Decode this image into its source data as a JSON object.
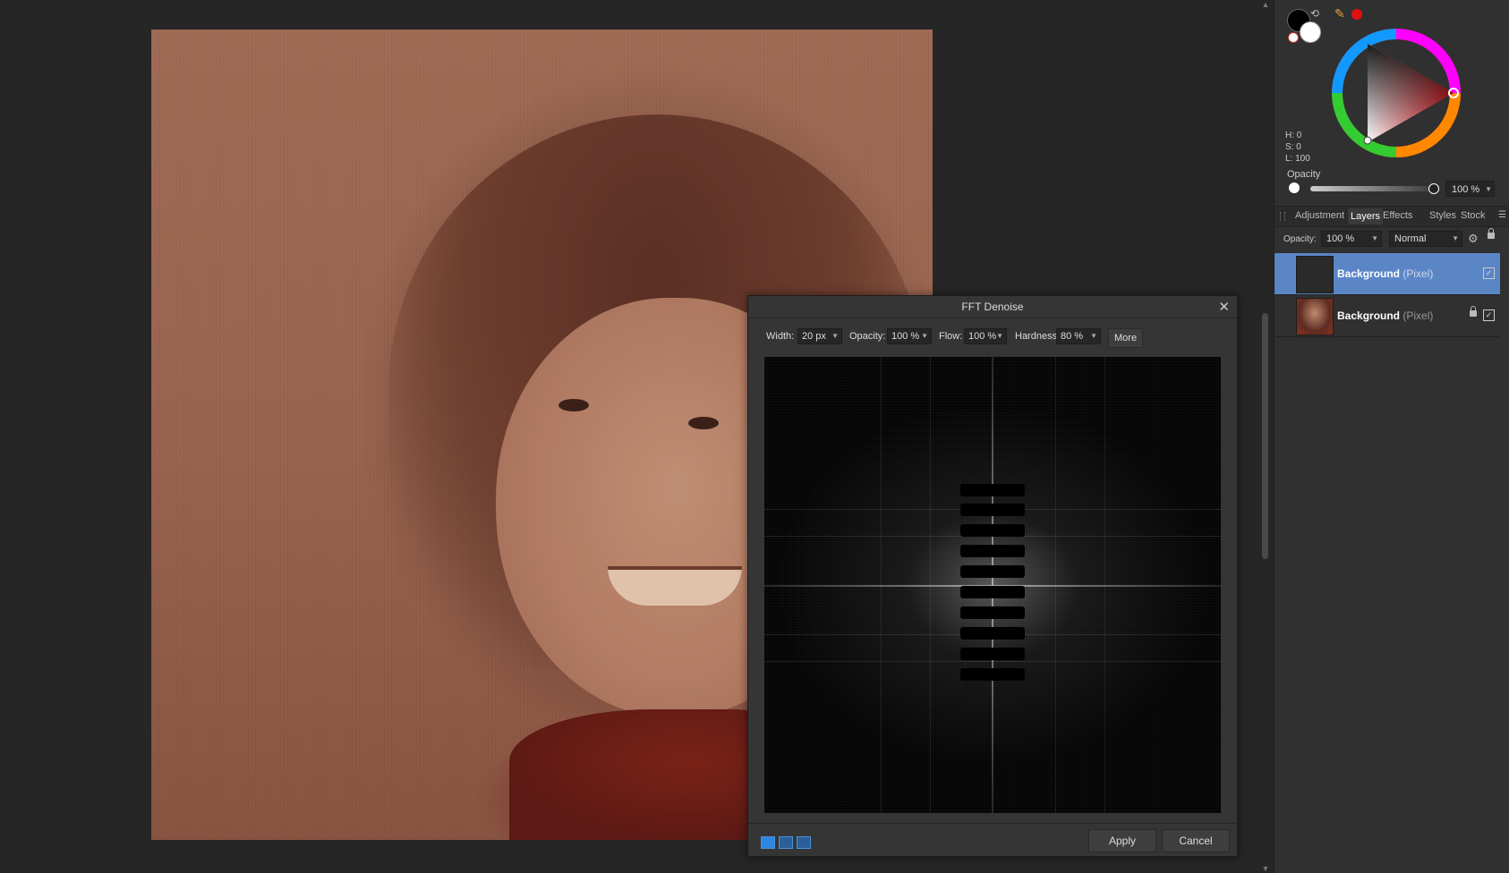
{
  "canvas": {},
  "color_panel": {
    "hsl": {
      "h": "H: 0",
      "s": "S: 0",
      "l": "L: 100"
    },
    "opacity_label": "Opacity",
    "opacity_value": "100 %",
    "colors": {
      "foreground": "#000000",
      "background": "#ffffff",
      "accent": "#e01010"
    }
  },
  "tabs": [
    "Adjustment",
    "Layers",
    "Effects",
    "Styles",
    "Stock"
  ],
  "active_tab": "Layers",
  "layer_controls": {
    "opacity_label": "Opacity:",
    "opacity_value": "100 %",
    "blend_mode": "Normal"
  },
  "layers": [
    {
      "name": "Background",
      "type": "(Pixel)",
      "selected": true,
      "locked": false,
      "visible": true
    },
    {
      "name": "Background",
      "type": "(Pixel)",
      "selected": false,
      "locked": true,
      "visible": true
    }
  ],
  "dialog": {
    "title": "FFT Denoise",
    "width_label": "Width:",
    "width_value": "20 px",
    "opacity_label": "Opacity:",
    "opacity_value": "100 %",
    "flow_label": "Flow:",
    "flow_value": "100 %",
    "hardness_label": "Hardness",
    "hardness_value": "80 %",
    "more_label": "More",
    "apply_label": "Apply",
    "cancel_label": "Cancel"
  }
}
